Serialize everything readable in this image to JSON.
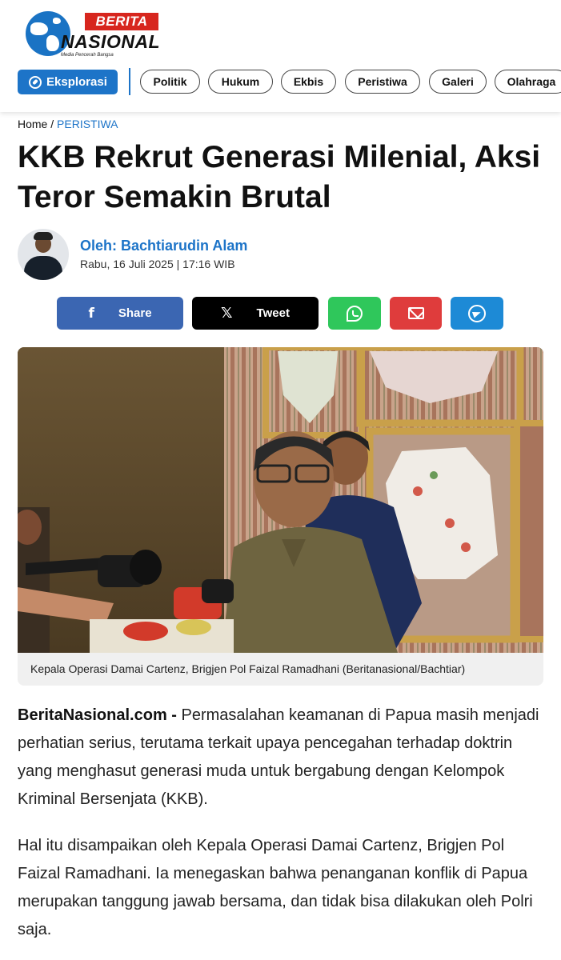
{
  "header": {
    "logo": {
      "badge_text": "BERITA",
      "wordmark": "NASIONAL",
      "tagline": "Media Pencerah Bangsa"
    },
    "nav": {
      "explore_label": "Eksplorasi",
      "items": [
        "Politik",
        "Hukum",
        "Ekbis",
        "Peristiwa",
        "Galeri",
        "Olahraga"
      ]
    }
  },
  "breadcrumb": {
    "home": "Home",
    "separator": "/",
    "category": "PERISTIWA"
  },
  "article": {
    "title": "KKB Rekrut Generasi Milenial, Aksi Teror Semakin Brutal",
    "author": "Oleh: Bachtiarudin Alam",
    "date": "Rabu, 16 Juli 2025 | 17:16 WIB",
    "image_caption": "Kepala Operasi Damai Cartenz, Brigjen Pol Faizal Ramadhani (Beritanasional/Bachtiar)",
    "lead_source": "BeritaNasional.com -",
    "paragraph_1": "Permasalahan keamanan di Papua masih menjadi perhatian serius, terutama terkait upaya pencegahan terhadap doktrin yang menghasut generasi muda untuk bergabung dengan Kelompok Kriminal Bersenjata (KKB).",
    "paragraph_2": "Hal itu disampaikan oleh Kepala Operasi Damai Cartenz, Brigjen Pol Faizal Ramadhani. Ia menegaskan bahwa penanganan konflik di Papua merupakan tanggung jawab bersama, dan tidak bisa dilakukan oleh Polri saja."
  },
  "share": {
    "facebook_label": "Share",
    "x_label": "Tweet",
    "icons": [
      "facebook-icon",
      "x-icon",
      "whatsapp-icon",
      "email-icon",
      "telegram-icon"
    ]
  },
  "colors": {
    "brand_blue": "#1d74c8",
    "brand_red": "#d7261e",
    "facebook": "#3b66b2",
    "x": "#000000",
    "whatsapp": "#2fc75b",
    "email": "#df3c3c",
    "telegram": "#1d8ad6"
  }
}
